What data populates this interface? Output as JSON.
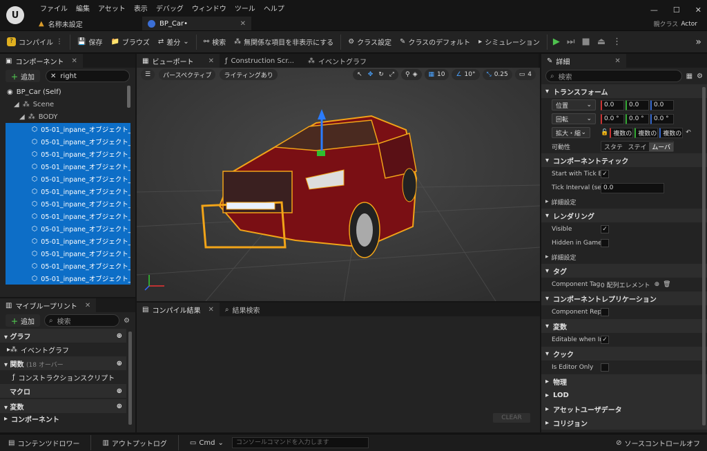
{
  "menu": {
    "items": [
      "ファイル",
      "編集",
      "アセット",
      "表示",
      "デバッグ",
      "ウィンドウ",
      "ツール",
      "ヘルプ"
    ]
  },
  "tabs": {
    "doc1": "名称未設定",
    "doc2": "BP_Car•"
  },
  "parent_class": {
    "label": "親クラス",
    "value": "Actor"
  },
  "toolbar": {
    "compile": "コンパイル",
    "save": "保存",
    "browse": "ブラウズ",
    "diff": "差分",
    "find": "検索",
    "hide_unrelated": "無関係な項目を非表示にする",
    "class_settings": "クラス設定",
    "class_defaults": "クラスのデフォルト",
    "simulation": "シミュレーション"
  },
  "components": {
    "tab": "コンポーネント",
    "add": "追加",
    "search_value": "right",
    "self": "BP_Car (Self)",
    "scene": "Scene",
    "body": "BODY",
    "items": [
      "05-01_inpane_オブジェクト_",
      "05-01_inpane_オブジェクト_",
      "05-01_inpane_オブジェクト_",
      "05-01_inpane_オブジェクト_",
      "05-01_inpane_オブジェクト_",
      "05-01_inpane_オブジェクト_",
      "05-01_inpane_オブジェクト_",
      "05-01_inpane_オブジェクト_",
      "05-01_inpane_オブジェクト_",
      "05-01_inpane_オブジェクト_",
      "05-01_inpane_オブジェクト_",
      "05-01_inpane_オブジェクト_",
      "05-01_inpane_オブジェクト_"
    ]
  },
  "blueprint": {
    "tab": "マイブループリント",
    "add": "追加",
    "search_placeholder": "検索",
    "graph": "グラフ",
    "event_graph": "イベントグラフ",
    "functions": "関数",
    "functions_note": "(18 オーバー",
    "construction": "コンストラクションスクリプト",
    "macro": "マクロ",
    "variables": "変数",
    "components": "コンポーネント"
  },
  "editor_tabs": {
    "viewport": "ビューポート",
    "construction": "Construction Scr...",
    "event_graph": "イベントグラフ"
  },
  "viewport": {
    "perspective": "パースペクティブ",
    "lighting": "ライティングあり",
    "grid": "10",
    "angle": "10°",
    "scale": "0.25",
    "camera": "4"
  },
  "compiler": {
    "tab": "コンパイル結果",
    "find_tab": "結果検索",
    "clear": "CLEAR"
  },
  "details": {
    "tab": "詳細",
    "search_placeholder": "検索",
    "transform": "トランスフォーム",
    "location": "位置",
    "rotation": "回転",
    "scale": "拡大・縮",
    "loc": [
      "0.0",
      "0.0",
      "0.0"
    ],
    "rot": [
      "0.0 °",
      "0.0 °",
      "0.0 °"
    ],
    "scl": [
      "複数の",
      "複数の",
      "複数の"
    ],
    "mobility": "可動性",
    "mob_opts": [
      "スタテ",
      "ステイ",
      "ムーバ"
    ],
    "tick": "コンポーネントティック",
    "start_tick": "Start with Tick En...",
    "tick_interval": "Tick Interval (secs)",
    "tick_interval_val": "0.0",
    "advanced": "詳細設定",
    "rendering": "レンダリング",
    "visible": "Visible",
    "hidden": "Hidden in Game",
    "tags_cat": "タグ",
    "comp_tags": "Component Tags",
    "tags_val": "0 配列エレメント",
    "replication": "コンポーネントレプリケーション",
    "comp_repl": "Component Repli...",
    "variable": "変数",
    "editable": "Editable when Inh...",
    "cook": "クック",
    "editor_only": "Is Editor Only",
    "physics": "物理",
    "lod": "LOD",
    "asset_user": "アセットユーザデータ",
    "collision": "コリジョン"
  },
  "statusbar": {
    "content_drawer": "コンテンツドロワー",
    "output_log": "アウトプットログ",
    "cmd": "Cmd",
    "console_placeholder": "コンソールコマンドを入力します",
    "source_control": "ソースコントロールオフ"
  }
}
